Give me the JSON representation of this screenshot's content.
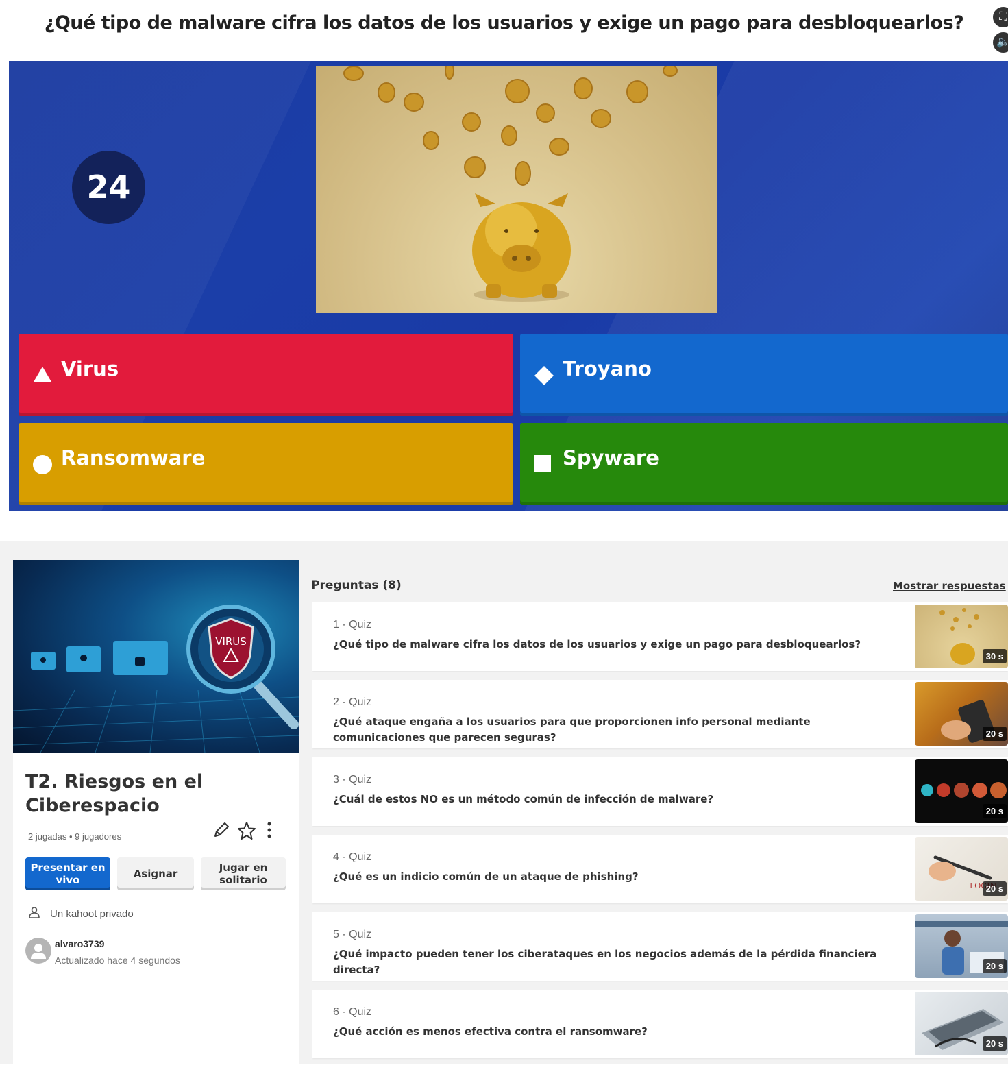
{
  "game": {
    "question": "¿Qué tipo de malware cifra los datos de los usuarios y exige un pago para desbloquearlos?",
    "timer": "24",
    "answers": {
      "red": "Virus",
      "blue": "Troyano",
      "yellow": "Ransomware",
      "green": "Spyware"
    },
    "colors": {
      "red": "#e21b3c",
      "blue": "#1368ce",
      "yellow": "#d89e00",
      "green": "#26890c",
      "stage": "#1a3aa6"
    },
    "icons": [
      "fullscreen-icon",
      "sound-icon"
    ]
  },
  "details": {
    "cover_badge": "VIRUS",
    "title": "T2. Riesgos en el Ciberespacio",
    "meta": "2 jugadas • 9 jugadores",
    "buttons": {
      "present": "Presentar en vivo",
      "assign": "Asignar",
      "solo": "Jugar en solitario"
    },
    "privacy": "Un kahoot privado",
    "owner": {
      "name": "alvaro3739",
      "updated": "Actualizado hace 4 segundos"
    },
    "questions_header": "Preguntas (8)",
    "show_answers": "Mostrar respuestas",
    "questions": [
      {
        "type": "1 - Quiz",
        "text": "¿Qué tipo de malware cifra los datos de los usuarios y exige un pago para desbloquearlos?",
        "time": "30 s"
      },
      {
        "type": "2 - Quiz",
        "text": "¿Qué ataque engaña a los usuarios para que proporcionen info personal mediante comunicaciones que parecen seguras?",
        "time": "20 s"
      },
      {
        "type": "3 - Quiz",
        "text": "¿Cuál de estos NO es un método común de infección de malware?",
        "time": "20 s"
      },
      {
        "type": "4 - Quiz",
        "text": "¿Qué es un indicio común de un ataque de phishing?",
        "time": "20 s"
      },
      {
        "type": "5 - Quiz",
        "text": "¿Qué impacto pueden tener los ciberataques en los negocios además de la pérdida financiera directa?",
        "time": "20 s"
      },
      {
        "type": "6 - Quiz",
        "text": "¿Qué acción es menos efectiva contra el ransomware?",
        "time": "20 s"
      }
    ]
  }
}
